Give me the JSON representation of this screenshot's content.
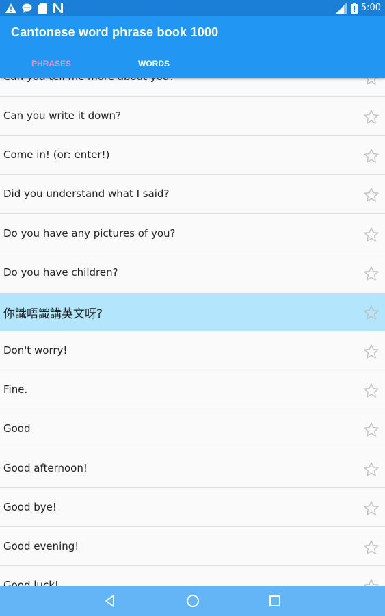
{
  "status_bar": {
    "time": "5:00",
    "left_icons": [
      "warning-icon",
      "chat-icon",
      "sd-card-icon",
      "n-icon"
    ],
    "right_icons": [
      "signal-icon",
      "battery-icon"
    ]
  },
  "app_bar": {
    "title": "Cantonese word phrase book 1000",
    "tabs": [
      {
        "label": "PHRASES",
        "active": true
      },
      {
        "label": "WORDS",
        "active": false
      }
    ]
  },
  "colors": {
    "primary": "#2196f3",
    "status_bar": "#1b7fd8",
    "active_tab": "#f48fb1",
    "selected_row": "#b3e5fc",
    "nav_bar": "#64b5f6"
  },
  "phrases": [
    {
      "text": "Can you tell me more about you?",
      "selected": false
    },
    {
      "text": "Can you write it down?",
      "selected": false
    },
    {
      "text": "Come in! (or: enter!)",
      "selected": false
    },
    {
      "text": "Did you understand what I said?",
      "selected": false
    },
    {
      "text": "Do you have any pictures of you?",
      "selected": false
    },
    {
      "text": "Do you have children?",
      "selected": false
    },
    {
      "text": "你識唔識講英文呀?",
      "selected": true
    },
    {
      "text": "Don't worry!",
      "selected": false
    },
    {
      "text": "Fine.",
      "selected": false
    },
    {
      "text": "Good",
      "selected": false
    },
    {
      "text": "Good afternoon!",
      "selected": false
    },
    {
      "text": "Good bye!",
      "selected": false
    },
    {
      "text": "Good evening!",
      "selected": false
    },
    {
      "text": "Good luck!",
      "selected": false
    }
  ],
  "nav_bar": {
    "buttons": [
      "back-icon",
      "home-icon",
      "recents-icon"
    ]
  }
}
